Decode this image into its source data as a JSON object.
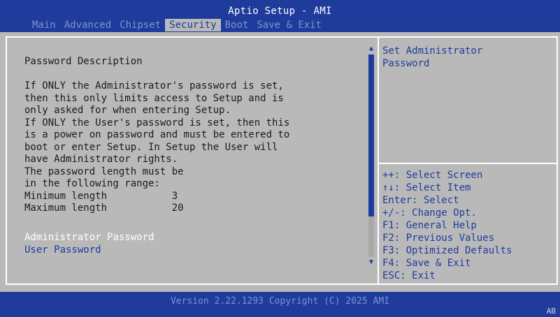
{
  "app": {
    "title": "Aptio Setup - AMI"
  },
  "tabs": [
    {
      "label": "Main"
    },
    {
      "label": "Advanced"
    },
    {
      "label": "Chipset"
    },
    {
      "label": "Security",
      "active": true
    },
    {
      "label": "Boot"
    },
    {
      "label": "Save & Exit"
    }
  ],
  "description": {
    "lines": [
      "Password Description",
      "",
      "If ONLY the Administrator's password is set,",
      "then this only limits access to Setup and is",
      "only asked for when entering Setup.",
      "If ONLY the User's password is set, then this",
      "is a power on password and must be entered to",
      "boot or enter Setup. In Setup the User will",
      "have Administrator rights.",
      "The password length must be",
      "in the following range:",
      "Minimum length           3",
      "Maximum length           20"
    ]
  },
  "items": {
    "admin_password": "Administrator Password",
    "user_password": "User Password"
  },
  "help": {
    "line1": "Set Administrator",
    "line2": "Password"
  },
  "keys": [
    "++: Select Screen",
    "↑↓: Select Item",
    "Enter: Select",
    "+/-: Change Opt.",
    "F1: General Help",
    "F2: Previous Values",
    "F3: Optimized Defaults",
    "F4: Save & Exit",
    "ESC: Exit"
  ],
  "footer": {
    "version": "Version 2.22.1293 Copyright (C) 2025 AMI",
    "badge": "AB"
  },
  "colors": {
    "bar_blue": "#1f3b9c",
    "panel_gray": "#b9b9b9",
    "inactive_tab": "#7f93cf",
    "selected_text": "#ffffff"
  },
  "icons": {
    "scroll_up": "scroll-up-arrow-icon",
    "scroll_down": "scroll-down-arrow-icon"
  }
}
